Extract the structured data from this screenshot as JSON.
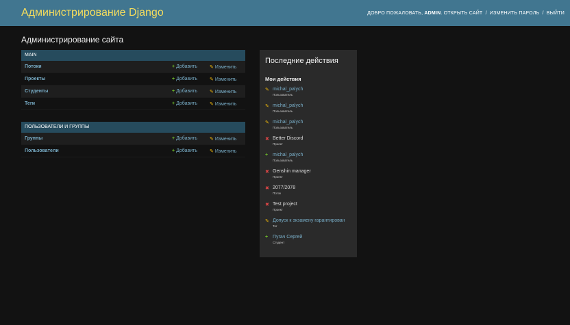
{
  "header": {
    "branding": "Администрирование Django",
    "welcome": "ДОБРО ПОЖАЛОВАТЬ,",
    "username": "ADMIN",
    "view_site": "ОТКРЫТЬ САЙТ",
    "change_password": "ИЗМЕНИТЬ ПАРОЛЬ",
    "logout": "ВЫЙТИ",
    "separator": "/"
  },
  "page_title": "Администрирование сайта",
  "actions": {
    "add": "Добавить",
    "change": "Изменить"
  },
  "apps": [
    {
      "caption": "MAIN",
      "models": [
        "Потоки",
        "Проекты",
        "Студенты",
        "Теги"
      ]
    },
    {
      "caption": "ПОЛЬЗОВАТЕЛИ И ГРУППЫ",
      "models": [
        "Группы",
        "Пользователи"
      ]
    }
  ],
  "recent": {
    "title": "Последние действия",
    "my_actions": "Мои действия",
    "items": [
      {
        "action": "change",
        "name": "michal_palych",
        "type": "Пользователь",
        "link": true
      },
      {
        "action": "change",
        "name": "michal_palych",
        "type": "Пользователь",
        "link": true
      },
      {
        "action": "change",
        "name": "michal_palych",
        "type": "Пользователь",
        "link": true
      },
      {
        "action": "delete",
        "name": "Better Discord",
        "type": "Проект",
        "link": false
      },
      {
        "action": "add",
        "name": "michal_palych",
        "type": "Пользователь",
        "link": true
      },
      {
        "action": "delete",
        "name": "Genshin manager",
        "type": "Проект",
        "link": false
      },
      {
        "action": "delete",
        "name": "2077/2078",
        "type": "Поток",
        "link": false
      },
      {
        "action": "delete",
        "name": "Test project",
        "type": "Проект",
        "link": false
      },
      {
        "action": "change",
        "name": "Допуск к экзамену гарантирован",
        "type": "Тег",
        "link": true
      },
      {
        "action": "add",
        "name": "Пугач Сергей",
        "type": "Студент",
        "link": true
      }
    ]
  }
}
